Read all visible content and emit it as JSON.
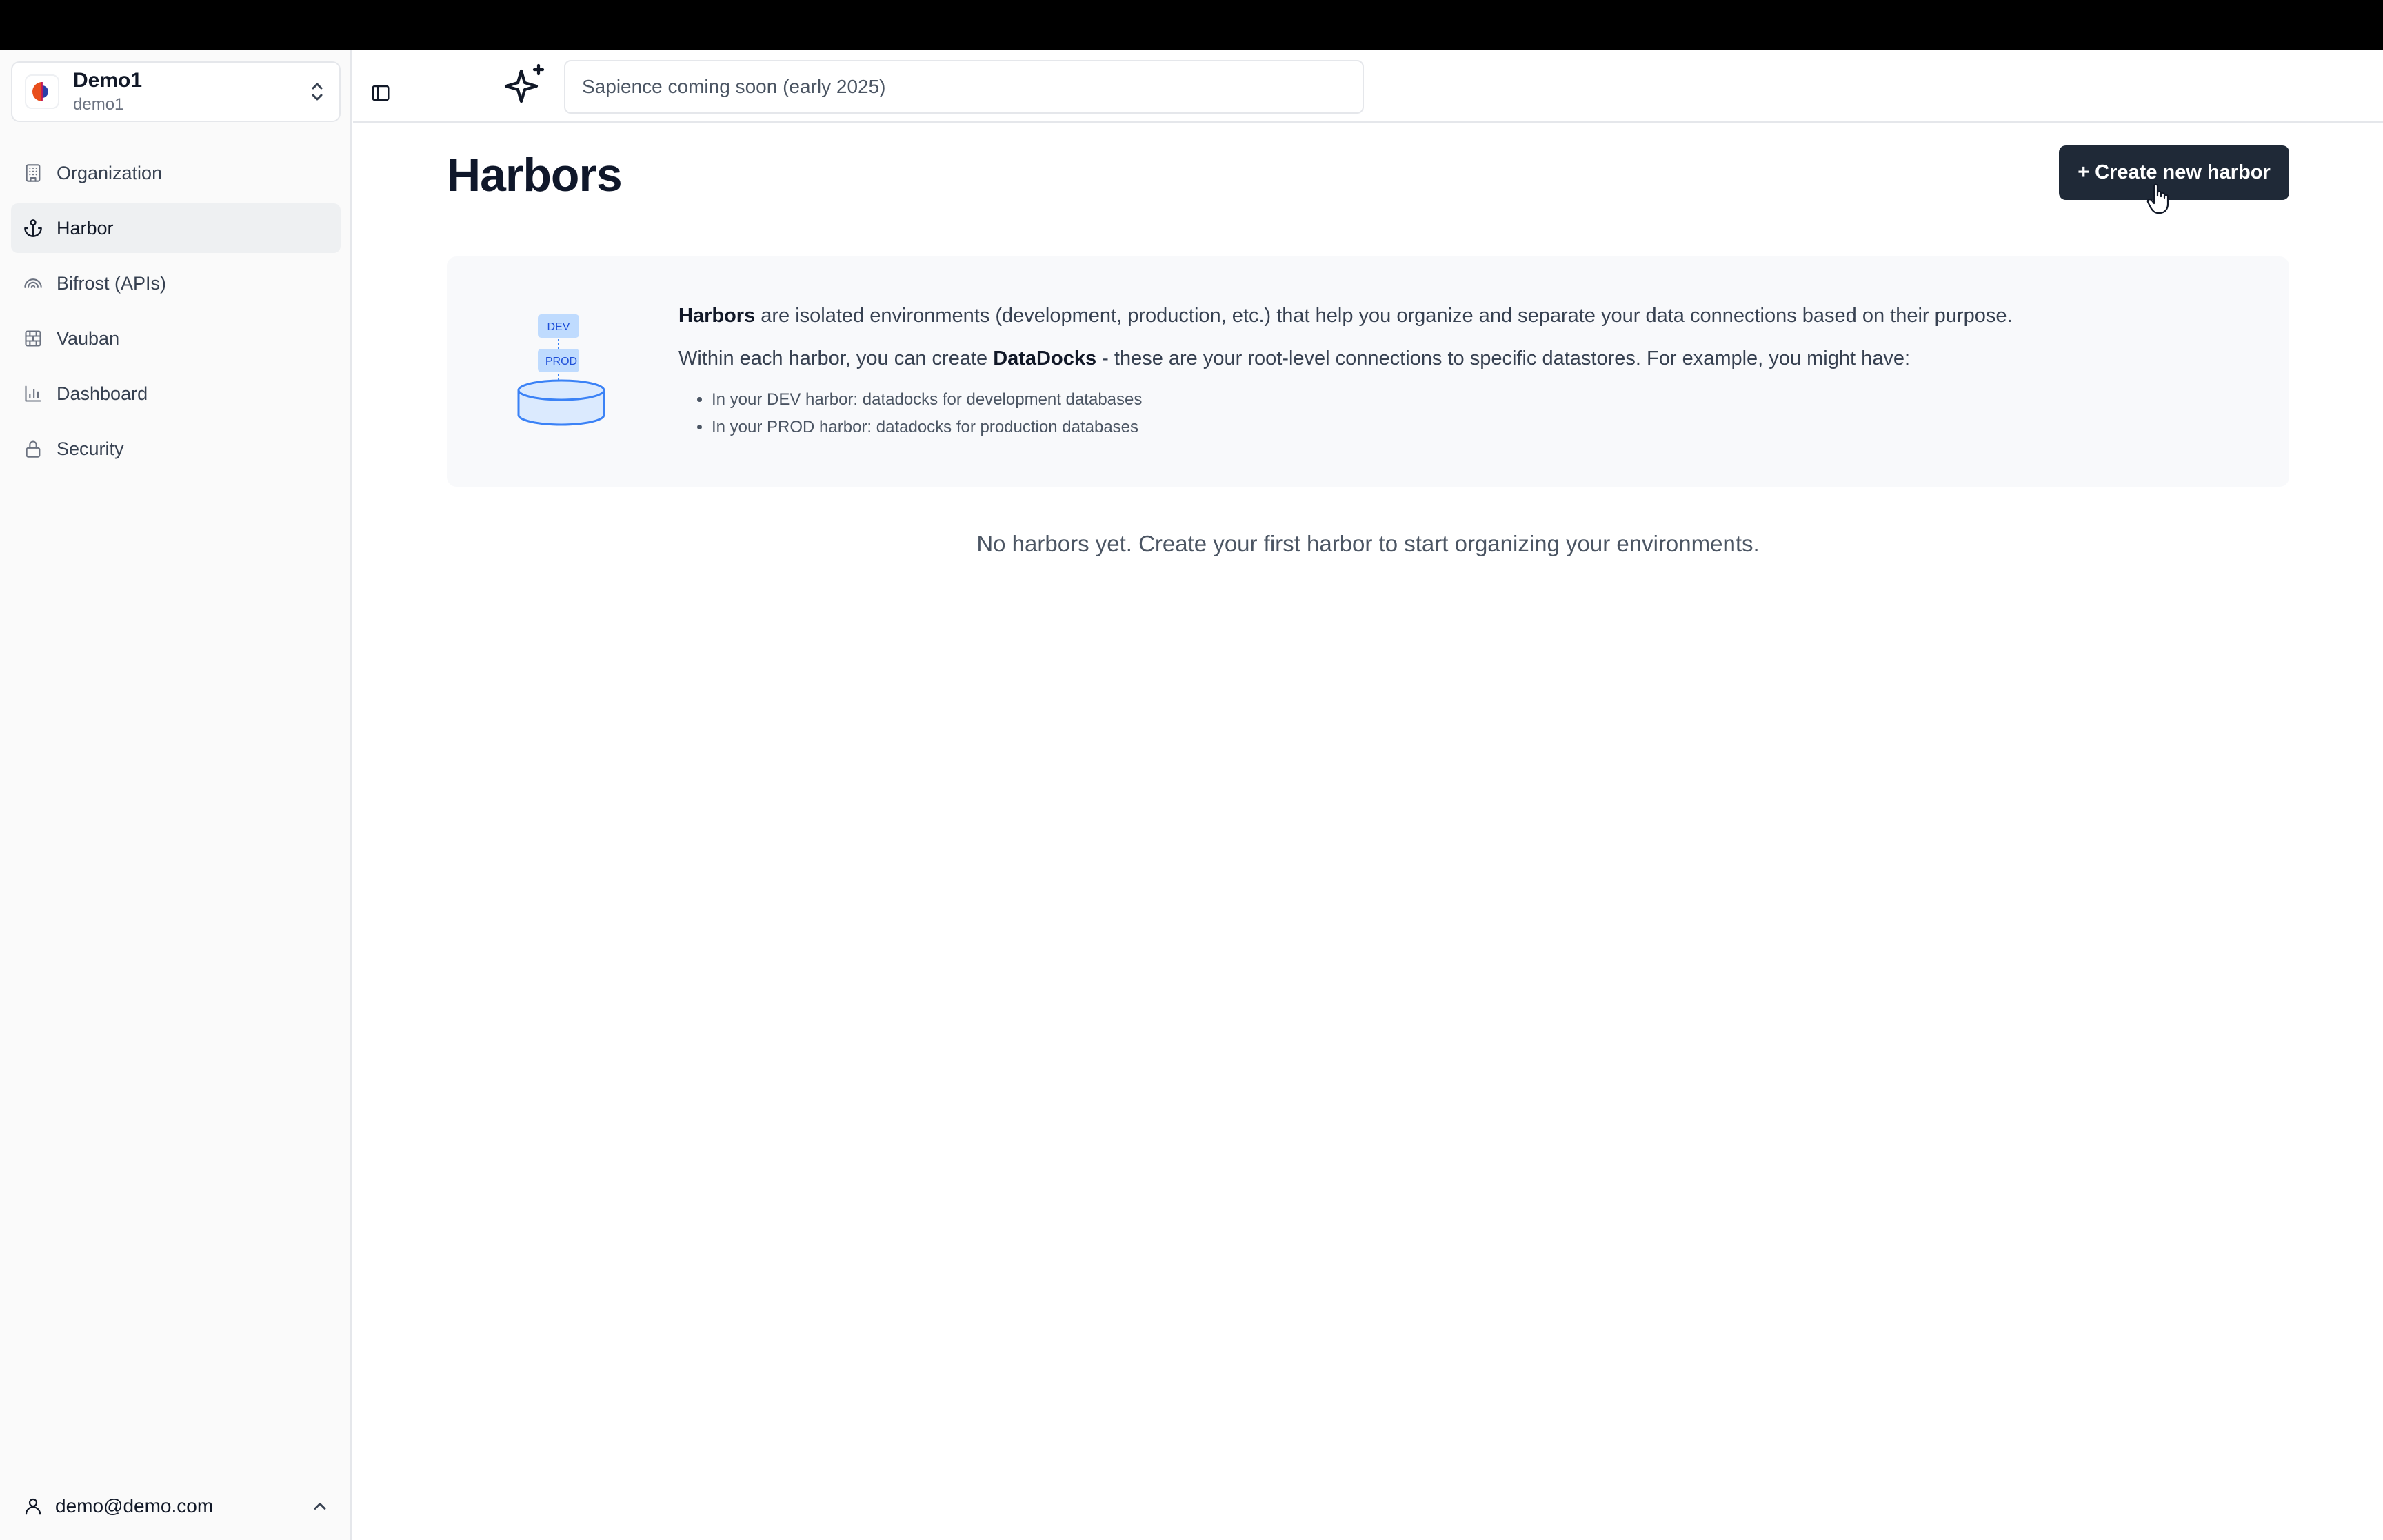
{
  "org": {
    "name": "Demo1",
    "slug": "demo1"
  },
  "sidebar": {
    "items": [
      {
        "label": "Organization",
        "icon": "building-icon",
        "active": false
      },
      {
        "label": "Harbor",
        "icon": "anchor-icon",
        "active": true
      },
      {
        "label": "Bifrost (APIs)",
        "icon": "rainbow-icon",
        "active": false
      },
      {
        "label": "Vauban",
        "icon": "brick-wall-icon",
        "active": false
      },
      {
        "label": "Dashboard",
        "icon": "bar-chart-icon",
        "active": false
      },
      {
        "label": "Security",
        "icon": "lock-icon",
        "active": false
      }
    ],
    "user_email": "demo@demo.com"
  },
  "header": {
    "search_placeholder": "Sapience coming soon (early 2025)"
  },
  "main": {
    "title": "Harbors",
    "create_button": "+ Create new harbor",
    "info": {
      "line1_bold": "Harbors",
      "line1_rest": " are isolated environments (development, production, etc.) that help you organize and separate your data connections based on their purpose.",
      "line2_start": "Within each harbor, you can create ",
      "line2_bold": "DataDocks",
      "line2_rest": " - these are your root-level connections to specific datastores. For example, you might have:",
      "bullets": [
        "In your DEV harbor: datadocks for development databases",
        "In your PROD harbor: datadocks for production databases"
      ],
      "illus_label_dev": "DEV",
      "illus_label_prod": "PROD"
    },
    "empty_message": "No harbors yet. Create your first harbor to start organizing your environments."
  },
  "colors": {
    "primary_button": "#1f2937",
    "illustration_blue": "#3b82f6",
    "illustration_fill": "#dbeafe"
  }
}
